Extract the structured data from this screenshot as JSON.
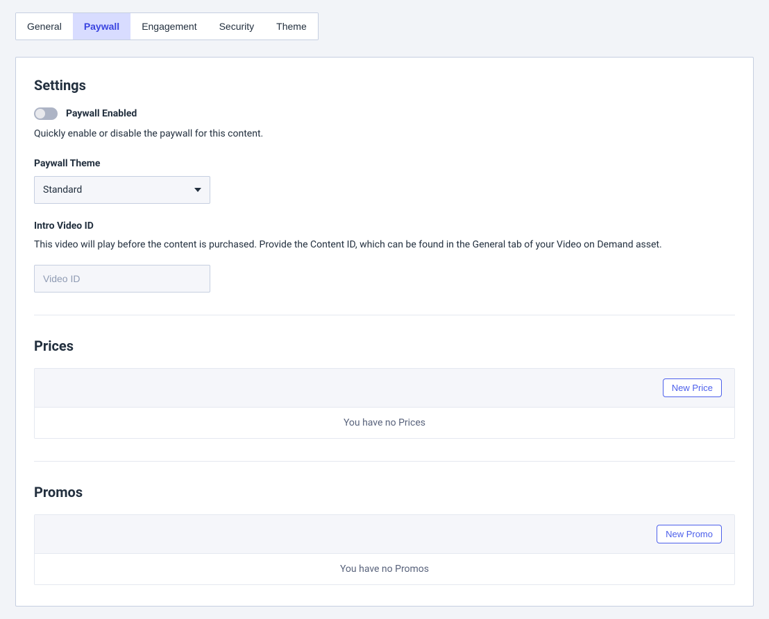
{
  "tabs": [
    {
      "label": "General",
      "active": false
    },
    {
      "label": "Paywall",
      "active": true
    },
    {
      "label": "Engagement",
      "active": false
    },
    {
      "label": "Security",
      "active": false
    },
    {
      "label": "Theme",
      "active": false
    }
  ],
  "settings": {
    "title": "Settings",
    "paywall_enabled_label": "Paywall Enabled",
    "paywall_enabled_desc": "Quickly enable or disable the paywall for this content.",
    "paywall_enabled_value": false,
    "theme_label": "Paywall Theme",
    "theme_value": "Standard",
    "intro_label": "Intro Video ID",
    "intro_desc": "This video will play before the content is purchased. Provide the Content ID, which can be found in the General tab of your Video on Demand asset.",
    "intro_placeholder": "Video ID",
    "intro_value": ""
  },
  "prices": {
    "title": "Prices",
    "new_button": "New Price",
    "empty_text": "You have no Prices"
  },
  "promos": {
    "title": "Promos",
    "new_button": "New Promo",
    "empty_text": "You have no Promos"
  }
}
